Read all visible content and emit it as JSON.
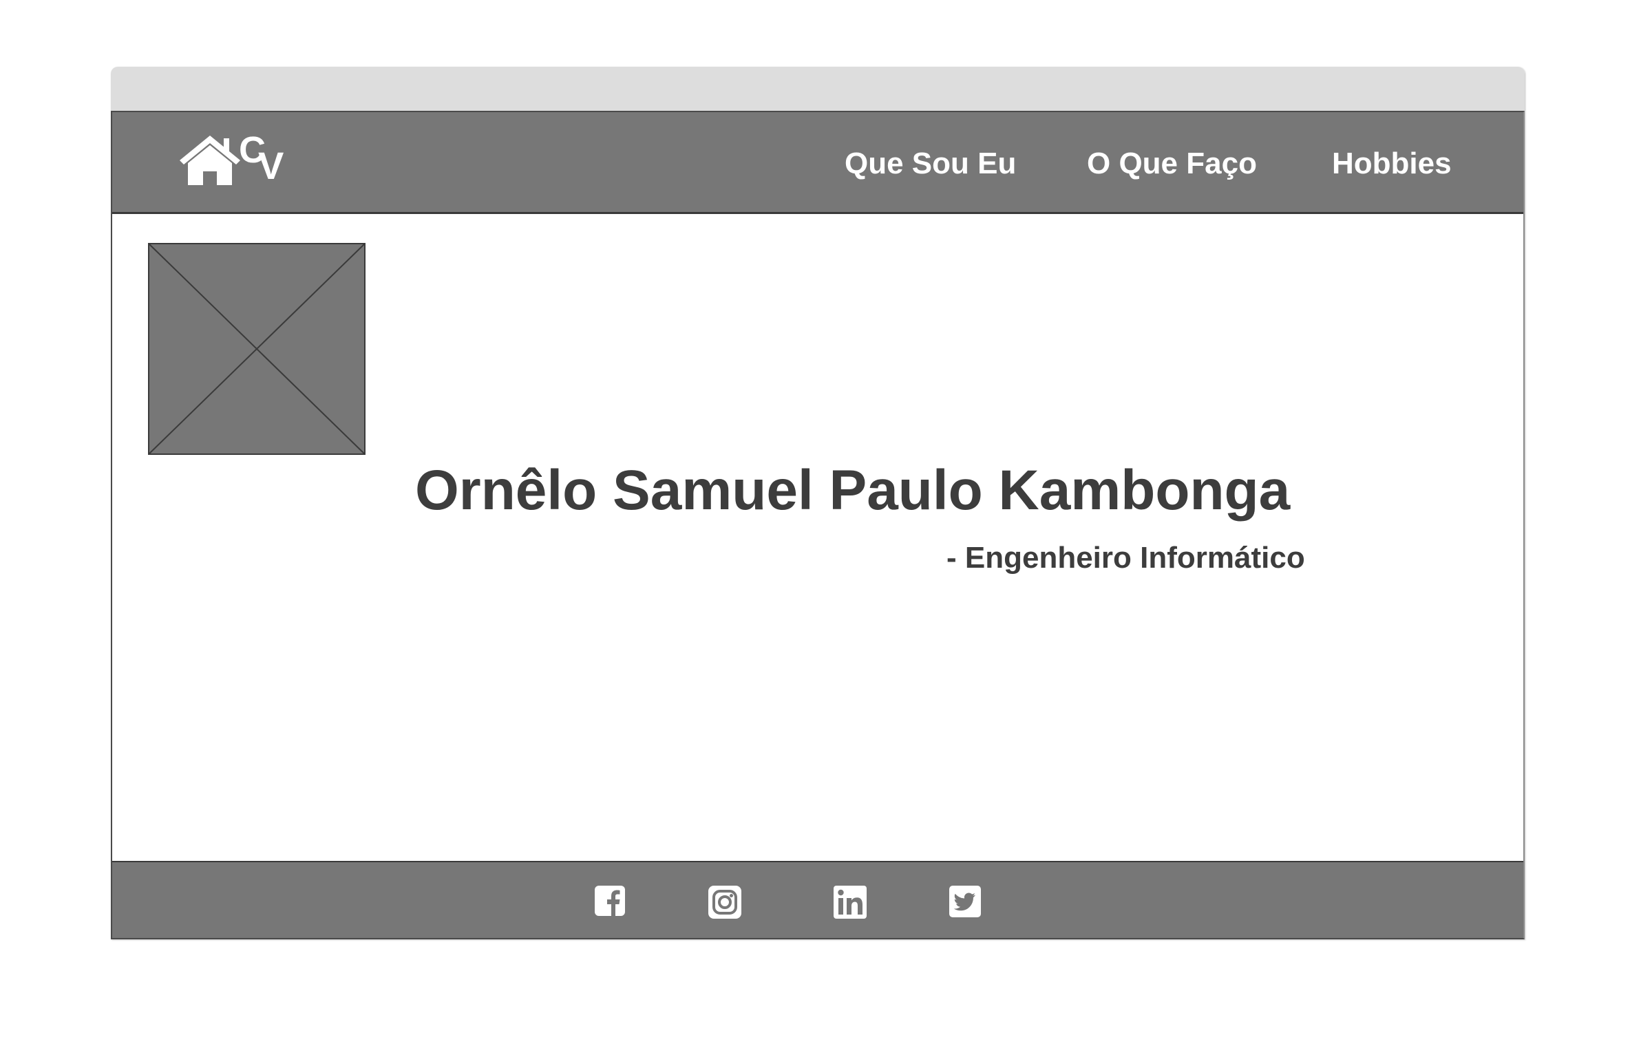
{
  "logo": {
    "icon": "house-icon",
    "letters": [
      "C",
      "V"
    ]
  },
  "nav": {
    "items": [
      {
        "label": "Que Sou Eu"
      },
      {
        "label": "O Que Faço"
      },
      {
        "label": "Hobbies"
      }
    ]
  },
  "hero": {
    "photo_icon": "image-placeholder",
    "name": "Ornêlo Samuel Paulo Kambonga",
    "role": "- Engenheiro Informático"
  },
  "footer": {
    "social": [
      {
        "icon": "facebook-icon"
      },
      {
        "icon": "instagram-icon"
      },
      {
        "icon": "linkedin-icon"
      },
      {
        "icon": "twitter-icon"
      }
    ]
  },
  "colors": {
    "bar": "#777777",
    "text": "#3d3d3d",
    "titlebar": "#dddddd"
  }
}
